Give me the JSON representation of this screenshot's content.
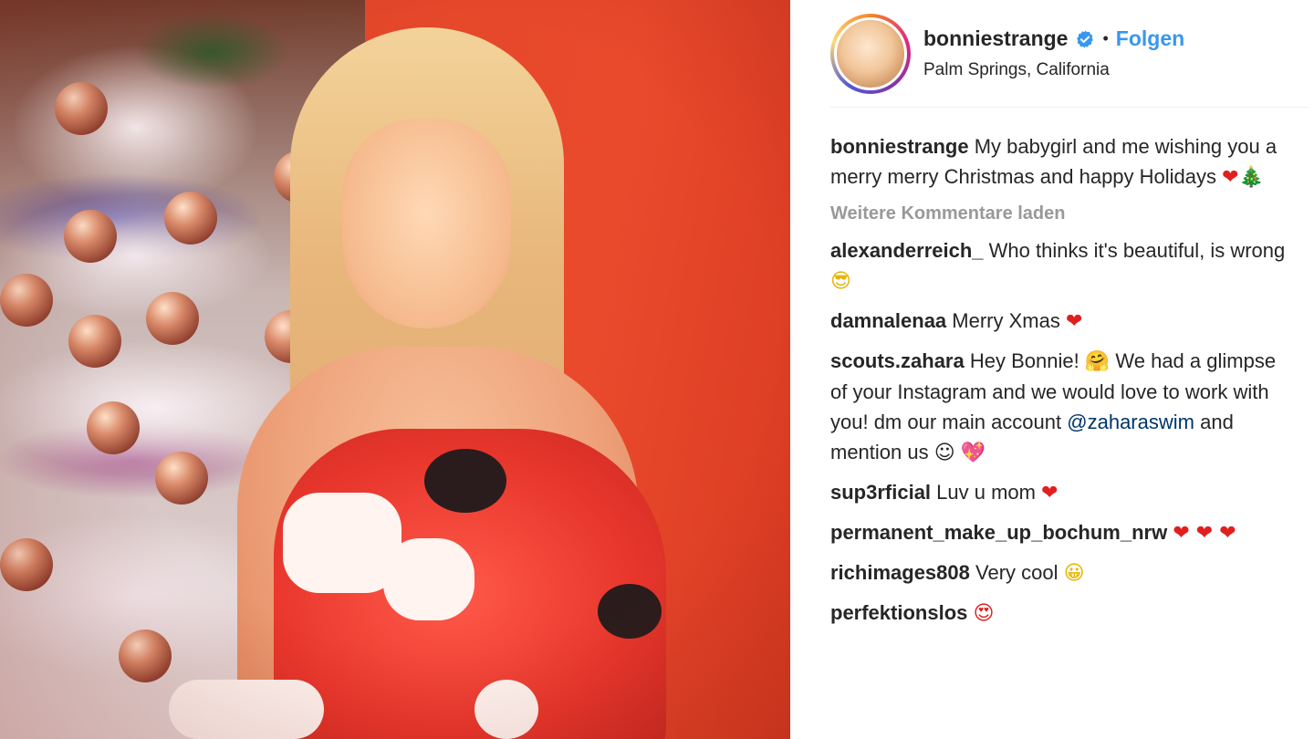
{
  "post": {
    "username": "bonniestrange",
    "follow_label": "Folgen",
    "separator": "•",
    "location": "Palm Springs, California"
  },
  "caption": {
    "username": "bonniestrange",
    "text": "My babygirl and me wishing you a merry merry Christmas and happy Holidays",
    "emoji": "❤🎄"
  },
  "load_more_label": "Weitere Kommentare laden",
  "comments": [
    {
      "username": "alexanderreich_",
      "text": "Who thinks it's beautiful, is wrong",
      "emoji": "😎"
    },
    {
      "username": "damnalenaa",
      "text": "Merry Xmas",
      "emoji": "❤"
    },
    {
      "username": "scouts.zahara",
      "text_a": "Hey Bonnie!",
      "emoji_a": "🤗",
      "text_b": "We had a glimpse of your Instagram and we would love to work with you! dm our main account",
      "mention": "@zaharaswim",
      "text_c": "and mention us",
      "emoji_b": "☺",
      "emoji_c": "💖"
    },
    {
      "username": "sup3rficial",
      "text": "Luv u mom",
      "emoji": "❤"
    },
    {
      "username": "permanent_make_up_bochum_nrw",
      "text": "",
      "emoji": "❤ ❤ ❤"
    },
    {
      "username": "richimages808",
      "text": "Very cool",
      "emoji": "😀"
    },
    {
      "username": "perfektionslos",
      "text": "",
      "emoji": "😍"
    }
  ],
  "colors": {
    "link": "#3897f0",
    "muted": "#999999",
    "heart": "#e0201e"
  },
  "icons": [
    "verified-badge-icon"
  ]
}
